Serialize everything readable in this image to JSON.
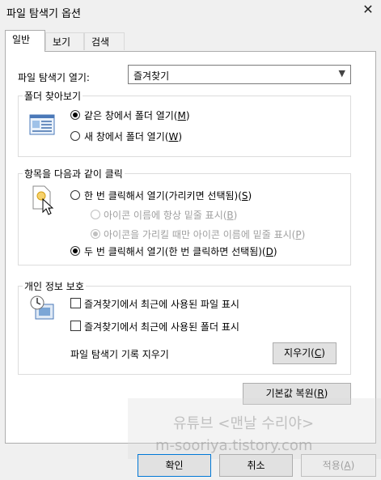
{
  "window": {
    "title": "파일 탐색기 옵션",
    "close_glyph": "✕"
  },
  "tabs": [
    {
      "label": "일반",
      "active": true
    },
    {
      "label": "보기",
      "active": false
    },
    {
      "label": "검색",
      "active": false
    }
  ],
  "open_explorer": {
    "label": "파일 탐색기 열기:",
    "value": "즐겨찾기"
  },
  "folder_browse": {
    "title": "폴더 찾아보기",
    "icon": "folder-window-icon",
    "options": [
      {
        "label": "같은 창에서 폴더 열기(",
        "key": "M",
        "selected": true
      },
      {
        "label": "새 창에서 폴더 열기(",
        "key": "W",
        "selected": false
      }
    ]
  },
  "click_items": {
    "title": "항목을 다음과 같이 클릭",
    "icon": "pointer-click-icon",
    "single": {
      "label": "한 번 클릭해서 열기(가리키면 선택됨)(",
      "key": "S",
      "selected": false
    },
    "underline_always": {
      "label": "아이콘 이름에 항상 밑줄 표시(",
      "key": "B",
      "selected": false,
      "disabled": true
    },
    "underline_hover": {
      "label": "아이콘을 가리킬 때만 아이콘 이름에 밑줄 표시(",
      "key": "P",
      "selected": true,
      "disabled": true
    },
    "double": {
      "label": "두 번 클릭해서 열기(한 번 클릭하면 선택됨)(",
      "key": "D",
      "selected": true
    }
  },
  "privacy": {
    "title": "개인 정보 보호",
    "icon": "privacy-icon",
    "recent_files": {
      "label": "즐겨찾기에서 최근에 사용된 파일 표시",
      "checked": false
    },
    "frequent_folders": {
      "label": "즐겨찾기에서 최근에 사용된 폴더 표시",
      "checked": false
    },
    "clear_history": "파일 탐색기 기록 지우기",
    "clear_button": {
      "label": "지우기(",
      "key": "C"
    }
  },
  "restore_defaults": {
    "label": "기본값 복원(",
    "key": "R"
  },
  "buttons": {
    "ok": "확인",
    "cancel": "취소",
    "apply": {
      "label": "적용(",
      "key": "A"
    }
  },
  "watermark": {
    "line1": "유튜브 <맨날 수리야>",
    "line2": "m-sooriya.tistory.com"
  }
}
